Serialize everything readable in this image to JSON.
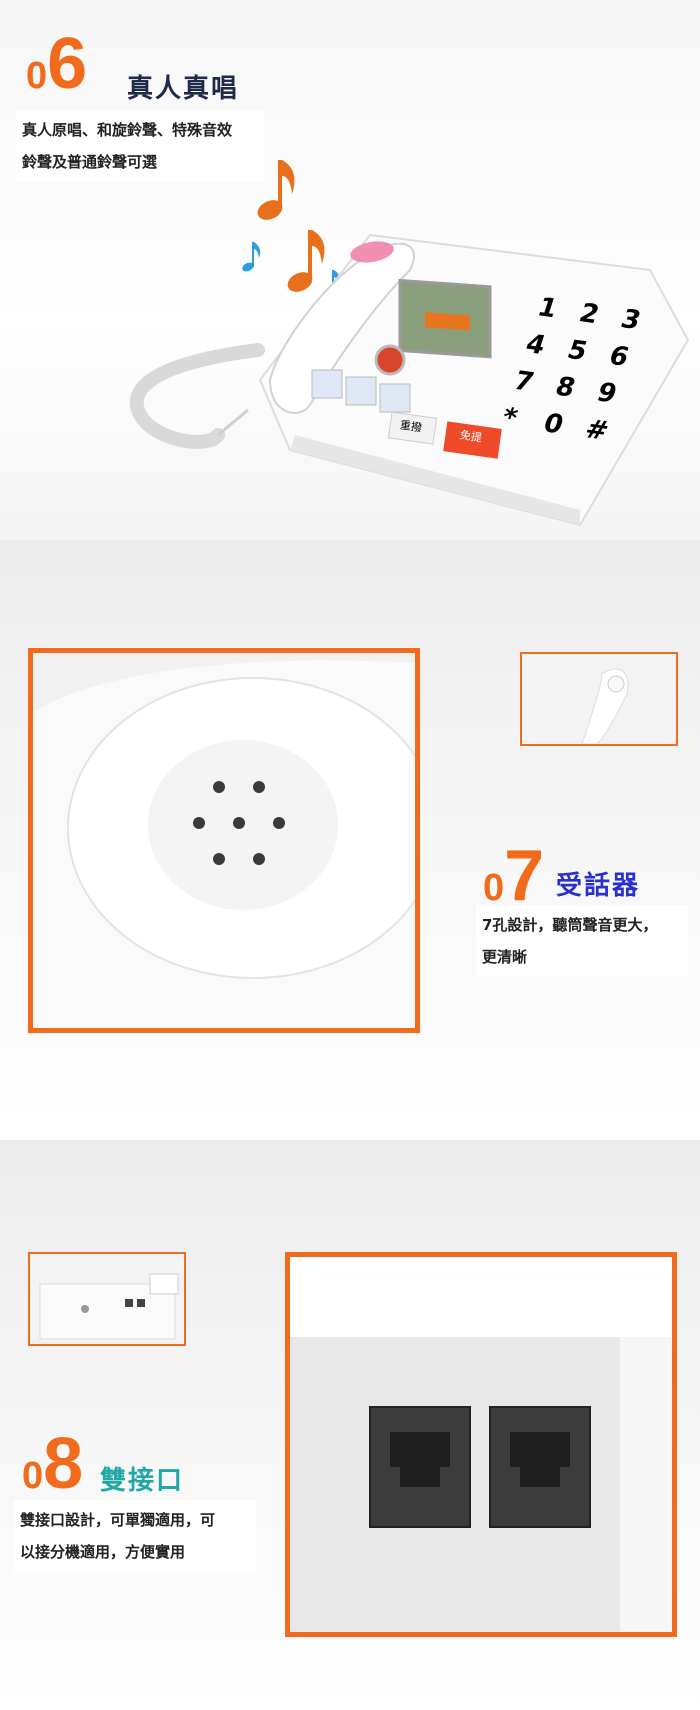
{
  "section6": {
    "num_zero": "0",
    "num_digit": "6",
    "title": "真人真唱",
    "desc_line1": "真人原唱、和旋鈴聲、特殊音效",
    "desc_line2": "鈴聲及普通鈴聲可選",
    "phone": {
      "keys": [
        "1",
        "2",
        "3",
        "4",
        "5",
        "6",
        "7",
        "8",
        "9",
        "*",
        "0",
        "#"
      ],
      "redial_label": "重撥",
      "handsfree_label": "免提"
    }
  },
  "section7": {
    "num_zero": "0",
    "num_digit": "7",
    "title": "受話器",
    "desc_line1": "7孔設計，聽筒聲音更大，",
    "desc_line2": "更清晰"
  },
  "section8": {
    "num_zero": "0",
    "num_digit": "8",
    "title": "雙接口",
    "desc_line1": "雙接口設計，可單獨適用，可",
    "desc_line2": "以接分機適用，方便實用"
  },
  "colors": {
    "accent": "#f26b1d",
    "title_dark": "#1e2a4a",
    "title_blue": "#2a2fd0",
    "title_teal": "#1fa8a6",
    "note_orange": "#e8701a",
    "note_blue": "#2e9ee0"
  }
}
